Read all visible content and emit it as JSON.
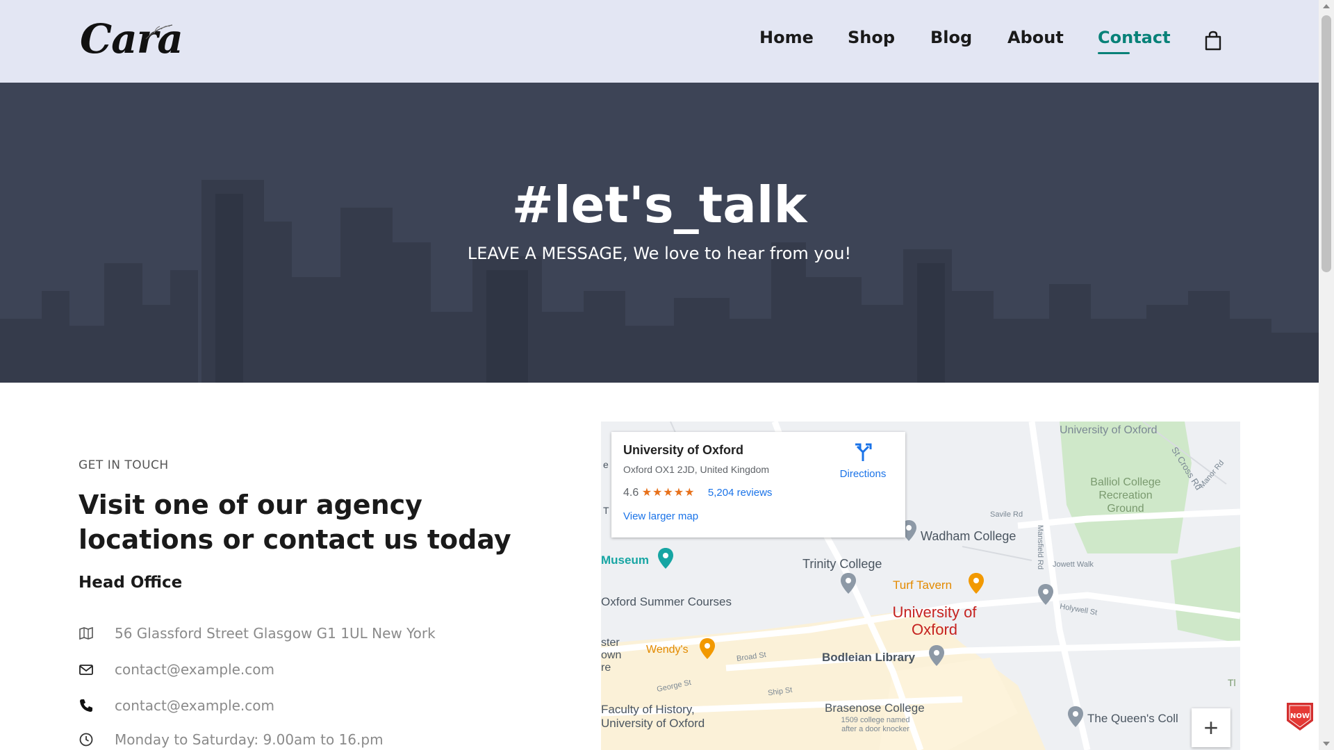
{
  "brand": {
    "logo_text": "Cara"
  },
  "nav": {
    "items": [
      {
        "label": "Home"
      },
      {
        "label": "Shop"
      },
      {
        "label": "Blog"
      },
      {
        "label": "About"
      },
      {
        "label": "Contact"
      }
    ],
    "active": "Contact",
    "accent_color": "#088178",
    "cart_icon": "shopping-bag-icon"
  },
  "hero": {
    "title": "#let's_talk",
    "subtitle": "LEAVE A MESSAGE, We love to hear from you!"
  },
  "contact": {
    "kicker": "GET IN TOUCH",
    "heading": "Visit one of our agency locations or contact us today",
    "office_title": "Head Office",
    "items": [
      {
        "icon": "map-icon",
        "text": "56 Glassford Street Glasgow G1 1UL New York"
      },
      {
        "icon": "envelope-icon",
        "text": "contact@example.com"
      },
      {
        "icon": "phone-icon",
        "text": "contact@example.com"
      },
      {
        "icon": "clock-icon",
        "text": "Monday to Saturday: 9.00am to 16.pm"
      }
    ]
  },
  "map": {
    "card": {
      "title": "University of Oxford",
      "address": "Oxford OX1 2JD, United Kingdom",
      "rating": "4.6",
      "stars": "★★★★★",
      "reviews": "5,204 reviews",
      "larger_map": "View larger map",
      "directions": "Directions"
    },
    "labels": {
      "univ_top": "University of Oxford",
      "balliol": "Balliol College Recreation Ground",
      "st_cross": "St Cross Rd",
      "mansfield": "Mansfield Rd",
      "savile": "Savile Rd",
      "parks": "Manor Rd",
      "wadham": "Wadham College",
      "museum": "Museum",
      "trinity": "Trinity College",
      "turf": "Turf Tavern",
      "jowett": "Jowett Walk",
      "holywell": "Holywell St",
      "summer": "Oxford Summer Courses",
      "univ_main": "University of Oxford",
      "ster": "ster",
      "own": "own",
      "re": "re",
      "wendys": "Wendy's",
      "broad": "Broad St",
      "bodleian": "Bodleian Library",
      "george": "George St",
      "ship": "Ship St",
      "history": "Faculty of History, University of Oxford",
      "brasenose": "Brasenose College",
      "brasenose_sub": "1509 college named after a door knocker",
      "queens": "The Queen's Coll",
      "e": "e",
      "t": "T",
      "y": "Tl"
    },
    "zoom_in": "+"
  },
  "badge": {
    "text": "NOW"
  }
}
